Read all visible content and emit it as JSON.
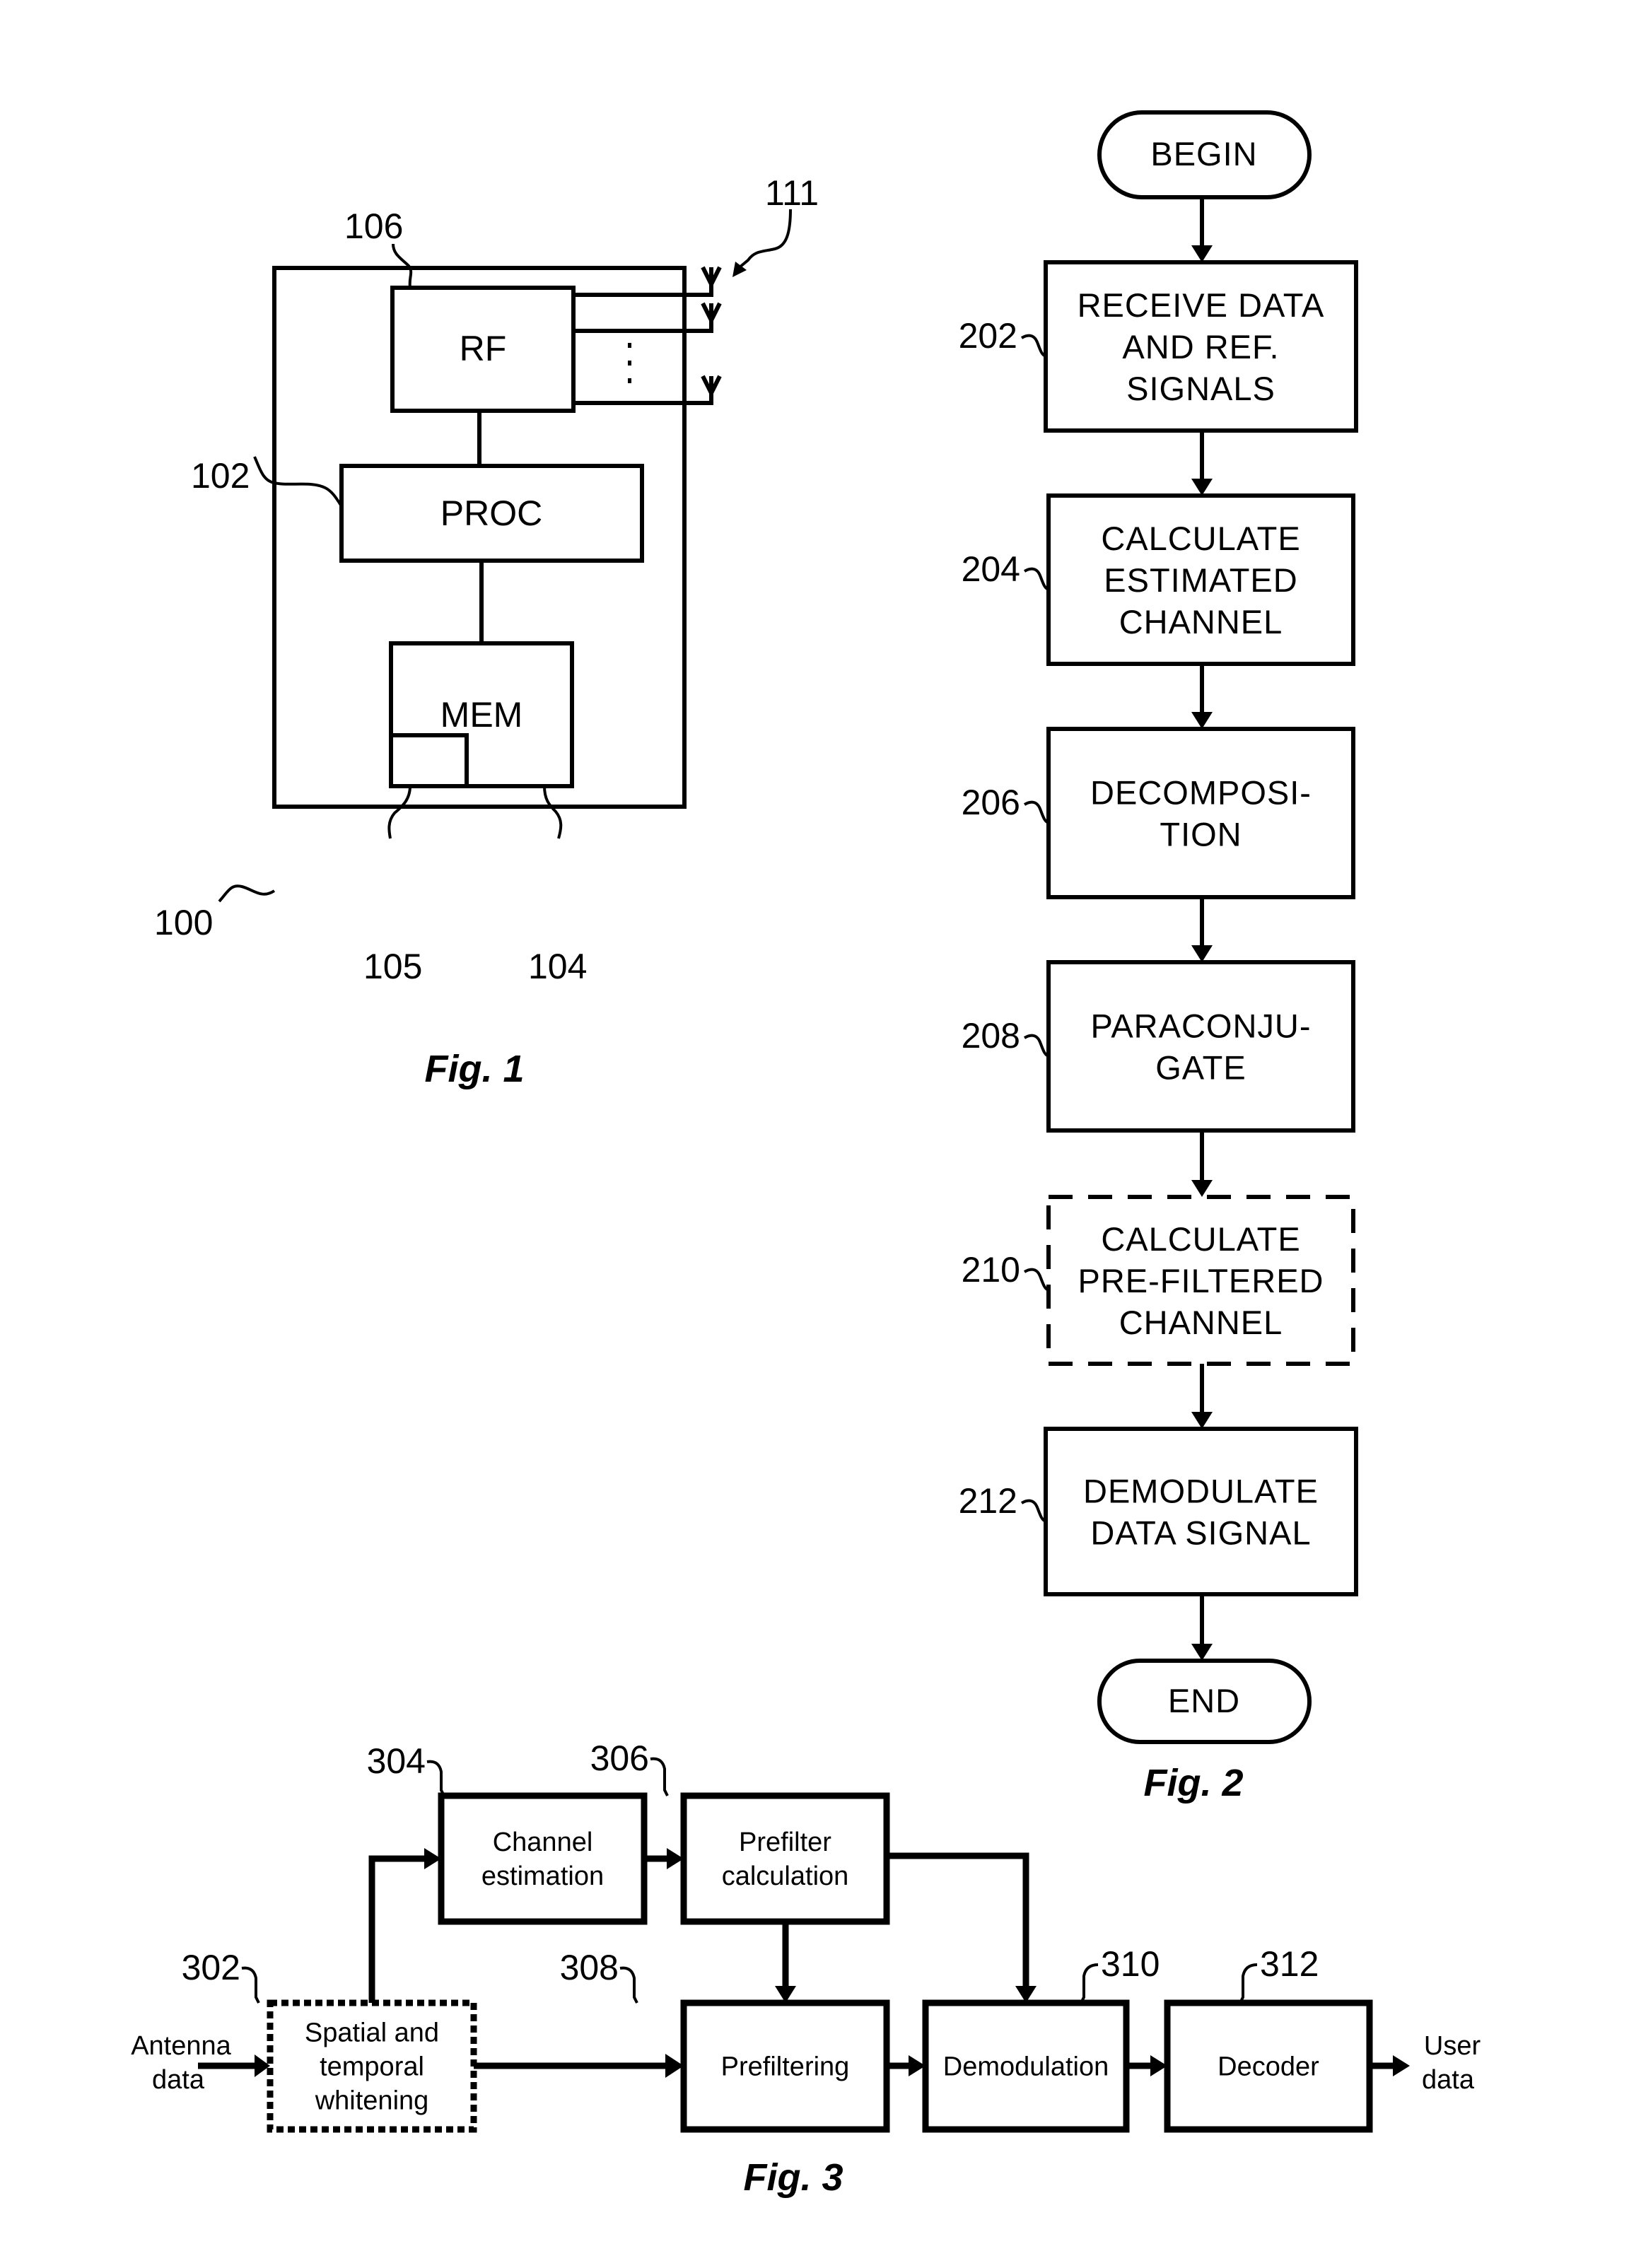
{
  "figures": {
    "fig1": {
      "caption": "Fig. 1",
      "blocks": {
        "rf": "RF",
        "proc": "PROC",
        "mem": "MEM"
      },
      "refs": {
        "device": "100",
        "processor": "102",
        "memory": "104",
        "program": "105",
        "rf": "106",
        "antennas": "111"
      },
      "ellipsis": "⋮"
    },
    "fig2": {
      "caption": "Fig. 2",
      "begin": "BEGIN",
      "end": "END",
      "steps": [
        {
          "ref": "202",
          "lines": [
            "RECEIVE DATA",
            "AND REF.",
            "SIGNALS"
          ],
          "optional": false
        },
        {
          "ref": "204",
          "lines": [
            "CALCULATE",
            "ESTIMATED",
            "CHANNEL"
          ],
          "optional": false
        },
        {
          "ref": "206",
          "lines": [
            "DECOMPOSI-",
            "TION"
          ],
          "optional": false
        },
        {
          "ref": "208",
          "lines": [
            "PARACONJU-",
            "GATE"
          ],
          "optional": false
        },
        {
          "ref": "210",
          "lines": [
            "CALCULATE",
            "PRE-FILTERED",
            "CHANNEL"
          ],
          "optional": true
        },
        {
          "ref": "212",
          "lines": [
            "DEMODULATE",
            "DATA SIGNAL"
          ],
          "optional": false
        }
      ]
    },
    "fig3": {
      "caption": "Fig. 3",
      "input_label": [
        "Antenna",
        "data"
      ],
      "output_label": [
        "User",
        "data"
      ],
      "blocks": {
        "whitening": {
          "ref": "302",
          "lines": [
            "Spatial and",
            "temporal",
            "whitening"
          ],
          "optional": true
        },
        "channel_estimation": {
          "ref": "304",
          "lines": [
            "Channel",
            "estimation"
          ],
          "optional": false
        },
        "prefilter_calculation": {
          "ref": "306",
          "lines": [
            "Prefilter",
            "calculation"
          ],
          "optional": false
        },
        "prefiltering": {
          "ref": "308",
          "lines": [
            "Prefiltering"
          ],
          "optional": false
        },
        "demodulation": {
          "ref": "310",
          "lines": [
            "Demodulation"
          ],
          "optional": false
        },
        "decoder": {
          "ref": "312",
          "lines": [
            "Decoder"
          ],
          "optional": false
        }
      }
    }
  }
}
